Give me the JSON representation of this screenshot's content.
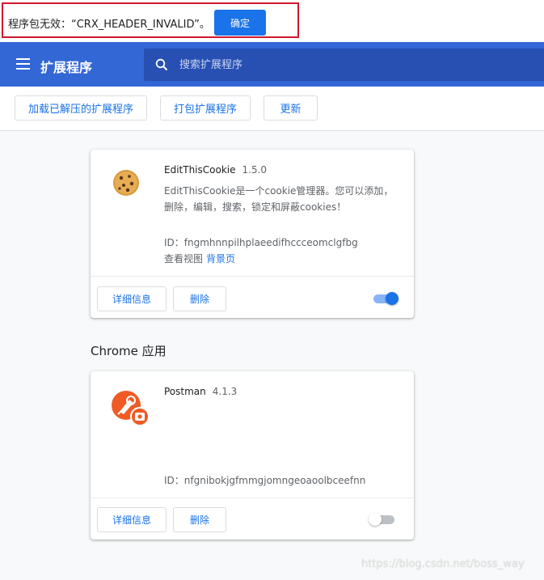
{
  "error_bar": {
    "message": "程序包无效：“CRX_HEADER_INVALID”。",
    "ok_label": "确定"
  },
  "toolbar": {
    "title": "扩展程序",
    "search_placeholder": "搜索扩展程序"
  },
  "actions": {
    "load_unpacked": "加载已解压的扩展程序",
    "pack": "打包扩展程序",
    "update": "更新"
  },
  "extensions": [
    {
      "name": "EditThisCookie",
      "version": "1.5.0",
      "description": "EditThisCookie是一个cookie管理器。您可以添加，删除，编辑，搜索，锁定和屏蔽cookies！",
      "id_text": "ID：fngmhnnpilhplaeedifhccceomclgfbg",
      "views_label": "查看视图",
      "views_link": "背景页",
      "details_label": "详细信息",
      "remove_label": "删除",
      "enabled": true
    }
  ],
  "apps_section_title": "Chrome 应用",
  "apps": [
    {
      "name": "Postman",
      "version": "4.1.3",
      "id_text": "ID：nfgnibokjgfmmgjomngeoaoolbceefnn",
      "details_label": "详细信息",
      "remove_label": "删除",
      "enabled": false
    }
  ],
  "watermark": "https://blog.csdn.net/boss_way",
  "colors": {
    "accent": "#1a73e8",
    "toolbar": "#3367d6",
    "search_bg": "#2850b3",
    "error_border": "#d0182c",
    "toggle_on_track": "#8ab4f8",
    "toggle_off_track": "#bdc1c6"
  },
  "icons": {
    "menu": "hamburger-menu-icon",
    "search": "search-icon",
    "ext_icon": "cookie-icon",
    "app_icon": "postman-icon"
  }
}
